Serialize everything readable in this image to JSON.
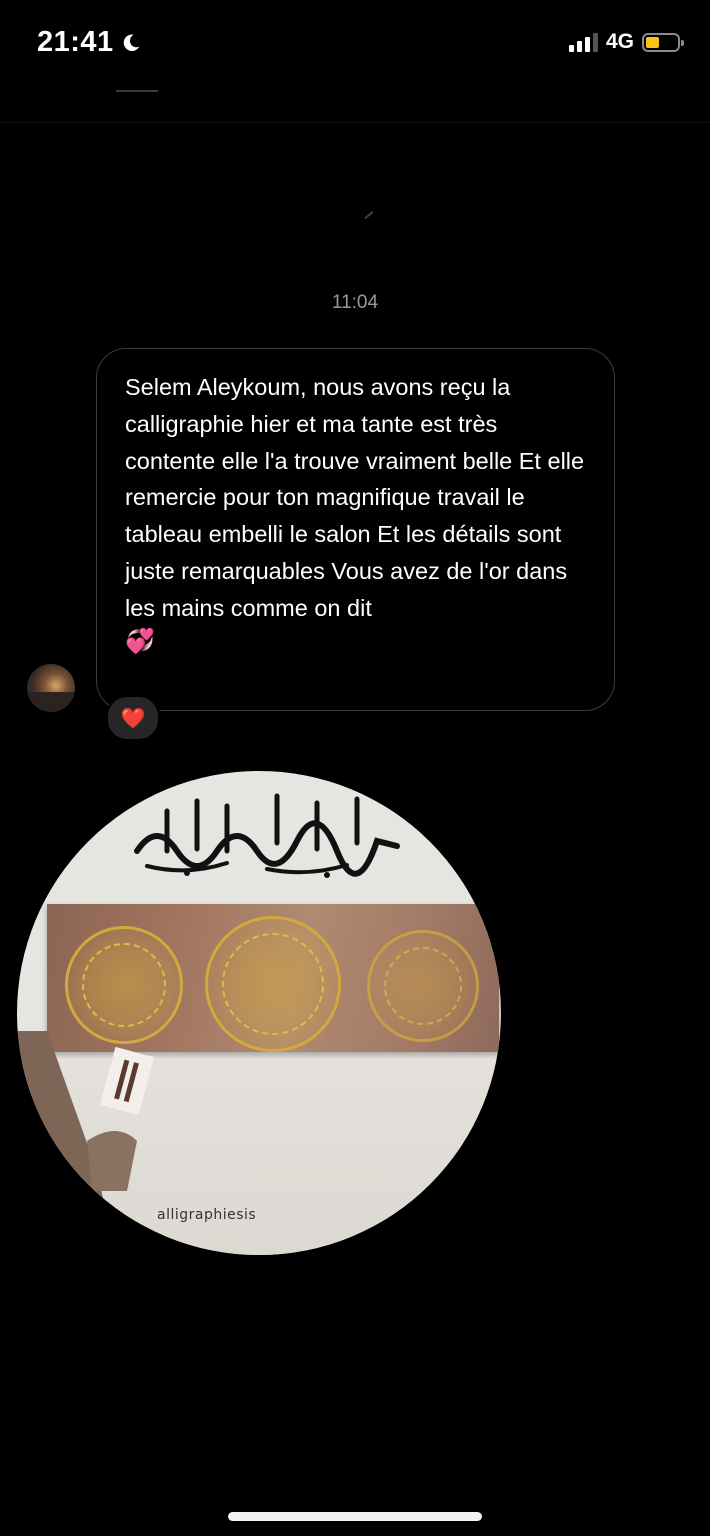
{
  "status_bar": {
    "time": "21:41",
    "network": "4G",
    "icons": [
      "moon-icon",
      "signal-icon",
      "battery-icon"
    ]
  },
  "conversation": {
    "timestamp": "11:04",
    "message": {
      "text": "Selem Aleykoum, nous avons reçu la calligraphie hier et ma tante est très contente elle l'a trouve vraiment belle Et elle remercie pour ton magnifique travail le tableau embelli le salon Et les détails sont juste remarquables Vous avez de l'or dans les mains comme on dit",
      "emoji": "💞",
      "reaction": "❤️"
    },
    "photo": {
      "watermark": "alligraphiesis"
    }
  },
  "colors": {
    "background": "#000000",
    "bubble_border": "#3c3c3c",
    "timestamp": "#9a9a9a",
    "battery": "#f5c518",
    "gold": "#d4a93b"
  }
}
